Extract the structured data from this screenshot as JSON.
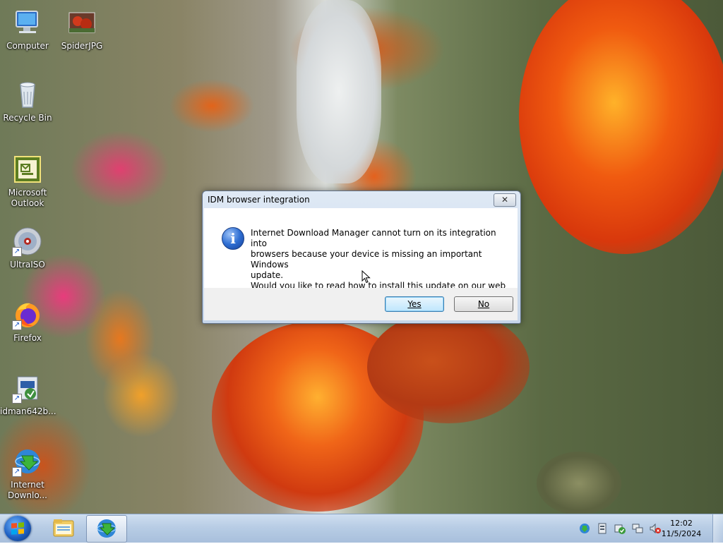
{
  "desktop": {
    "icons": [
      {
        "label": "Computer",
        "icon": "computer-icon"
      },
      {
        "label": "SpiderJPG",
        "icon": "image-file-icon"
      },
      {
        "label": "Recycle Bin",
        "icon": "recycle-bin-icon"
      },
      {
        "label": "Microsoft Outlook",
        "icon": "outlook-icon"
      },
      {
        "label": "UltraISO",
        "icon": "disc-icon"
      },
      {
        "label": "Firefox",
        "icon": "firefox-icon"
      },
      {
        "label": "idman642b...",
        "icon": "installer-icon"
      },
      {
        "label": "Internet Downlo...",
        "icon": "idm-icon"
      }
    ]
  },
  "dialog": {
    "title": "IDM browser integration",
    "close_label": "✕",
    "message_lines": [
      "Internet Download Manager cannot turn on its integration into",
      "browsers because your device is missing an important Windows",
      "update.",
      "Would you like to read how to install this update on our web site?"
    ],
    "icon": "info-icon",
    "yes_label": "Yes",
    "no_label": "No"
  },
  "taskbar": {
    "start": "windows-start-icon",
    "pinned": [
      "file-explorer-icon",
      "idm-icon"
    ],
    "tray_icons": [
      "idm-tray-icon",
      "device-icon",
      "security-check-icon",
      "network-icon",
      "volume-muted-icon"
    ],
    "clock_time": "12:02",
    "clock_date": "11/5/2024"
  }
}
